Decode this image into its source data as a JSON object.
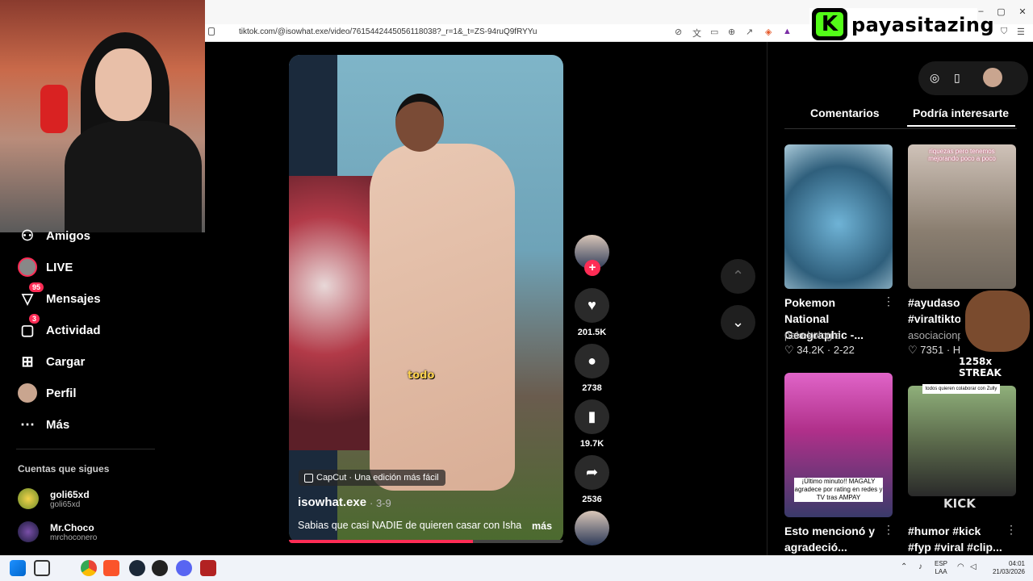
{
  "browser": {
    "url": "tiktok.com/@isowhat.exe/video/7615442445056118038?_r=1&_t=ZS-94ruQ9fRYYu",
    "window_controls": [
      "–",
      "▢",
      "✕"
    ]
  },
  "overlay": {
    "brand_letter": "K",
    "brand_name": "payasitazing",
    "streak": "1258x STREAK"
  },
  "sidebar": {
    "items": [
      {
        "label": "Amigos",
        "icon": "friends-icon"
      },
      {
        "label": "LIVE",
        "icon": "live-icon"
      },
      {
        "label": "Mensajes",
        "icon": "messages-icon",
        "badge": "95"
      },
      {
        "label": "Actividad",
        "icon": "activity-icon",
        "badge": "3"
      },
      {
        "label": "Cargar",
        "icon": "upload-icon"
      },
      {
        "label": "Perfil",
        "icon": "profile-icon"
      },
      {
        "label": "Más",
        "icon": "more-icon"
      }
    ],
    "following_header": "Cuentas que sigues",
    "following": [
      {
        "name": "goli65xd",
        "user": "goli65xd"
      },
      {
        "name": "Mr.Choco",
        "user": "mrchoconero"
      }
    ]
  },
  "video": {
    "caption_word": "todo",
    "capcut_label": "CapCut · Una edición más fácil",
    "author": "isowhat.exe",
    "date": "· 3-9",
    "description": "Sabias que casi NADIE de quieren casar con Isha",
    "more": "más",
    "progress": 0.67
  },
  "actions": {
    "likes": "201.5K",
    "comments": "2738",
    "saves": "19.7K",
    "shares": "2536"
  },
  "right_panel": {
    "tabs": [
      "Comentarios",
      "Podría interesarte"
    ],
    "active_tab": 1,
    "recommendations": [
      {
        "title": "Pokemon National Geographic -...",
        "author": "pokekologia",
        "likes": "34.2K",
        "date": "2-22",
        "thumb_text": ""
      },
      {
        "title": "#ayudasoc #viraltiktok",
        "author": "asociacionp",
        "likes": "7351",
        "date": "· H",
        "thumb_text": "riquezas pero tenemos mejorando poco a poco"
      },
      {
        "title": "Esto mencionó y agradeció...",
        "author": "",
        "likes": "",
        "date": "",
        "thumb_text": "¡Último minuto!! MAGALY agradece por rating en redes y TV tras AMPAY"
      },
      {
        "title": "#humor #kick #fyp #viral #clip...",
        "author": "",
        "likes": "",
        "date": "",
        "thumb_text": "KICK"
      }
    ],
    "thumb_banner": "todos quieren colaborar con Zully"
  },
  "taskbar": {
    "lang_top": "ESP",
    "lang_bottom": "LAA",
    "time": "04:01",
    "date": "21/03/2026"
  }
}
